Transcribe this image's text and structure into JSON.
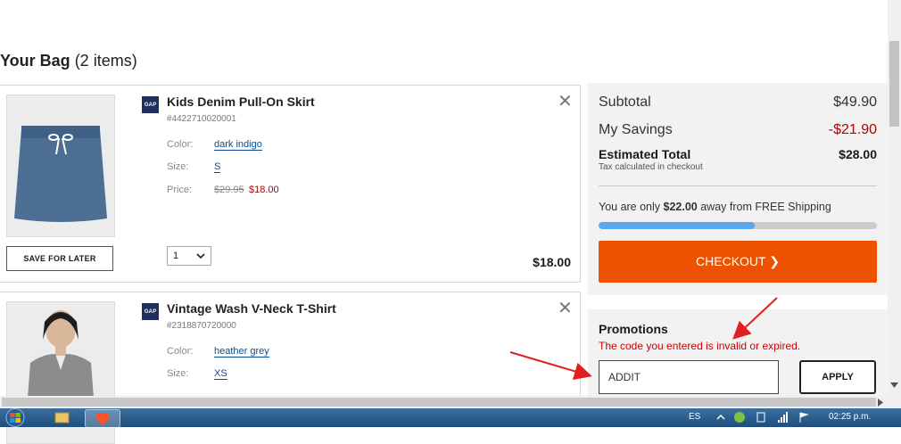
{
  "bag": {
    "title_bold": "Your Bag",
    "title_count": "(2 items)"
  },
  "items": [
    {
      "name": "Kids Denim Pull-On Skirt",
      "sku": "#4422710020001",
      "brand": "GAP",
      "color_label": "Color:",
      "color": "dark indigo",
      "size_label": "Size:",
      "size": "S",
      "price_label": "Price:",
      "old_price": "$29.95",
      "price": "$18.00",
      "quantity": "1",
      "line_total": "$18.00",
      "save_label": "SAVE FOR LATER",
      "remove": "✕"
    },
    {
      "name": "Vintage Wash V-Neck T-Shirt",
      "sku": "#2318870720000",
      "brand": "GAP",
      "color_label": "Color:",
      "color": "heather grey",
      "size_label": "Size:",
      "size": "XS",
      "remove": "✕"
    }
  ],
  "summary": {
    "subtotal_label": "Subtotal",
    "subtotal": "$49.90",
    "savings_label": "My Savings",
    "savings": "-$21.90",
    "estimated_label": "Estimated Total",
    "estimated": "$28.00",
    "tax_note": "Tax calculated in checkout",
    "shipping_prefix": "You are only ",
    "shipping_amount": "$22.00",
    "shipping_suffix": " away from FREE Shipping",
    "shipping_progress": 0.56,
    "checkout_label": "CHECKOUT ❯"
  },
  "promotions": {
    "title": "Promotions",
    "error": "The code you entered is invalid or expired.",
    "code_value": "ADDIT",
    "apply_label": "APPLY"
  },
  "taskbar": {
    "language": "ES",
    "time": "02:25 p.m."
  },
  "colors": {
    "checkout": "#ee5200",
    "savings": "#b30000",
    "error": "#cc0000",
    "link": "#0b4b91",
    "annotation_arrow": "#e02020"
  }
}
